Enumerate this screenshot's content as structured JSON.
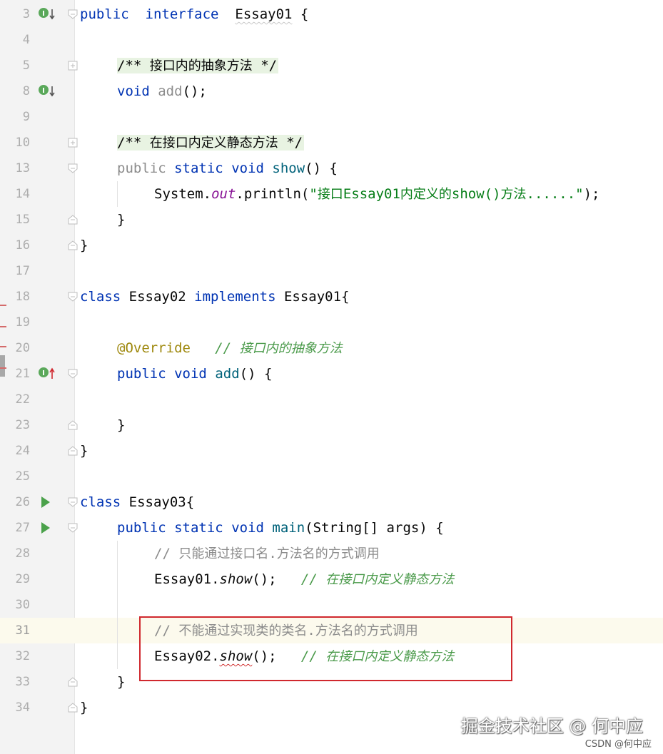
{
  "editor": {
    "lines": [
      {
        "num": "3",
        "segments": [
          [
            "kw",
            "public"
          ],
          [
            "",
            "  "
          ],
          [
            "kw",
            "interface"
          ],
          [
            "",
            "  "
          ],
          [
            "squig-soft",
            "Essay01"
          ],
          [
            "",
            " {"
          ]
        ]
      },
      {
        "num": "4",
        "segments": []
      },
      {
        "num": "5",
        "segments": [
          [
            "",
            ""
          ],
          [
            "doc",
            "/** 接口内的抽象方法 */"
          ]
        ]
      },
      {
        "num": "8",
        "segments": [
          [
            "kw",
            "void"
          ],
          [
            "",
            " "
          ],
          [
            "gray",
            "add"
          ],
          [
            "",
            "();"
          ]
        ]
      },
      {
        "num": "9",
        "segments": []
      },
      {
        "num": "10",
        "segments": [
          [
            "doc",
            "/** 在接口内定义静态方法 */"
          ]
        ]
      },
      {
        "num": "13",
        "segments": [
          [
            "gray",
            "public"
          ],
          [
            "",
            " "
          ],
          [
            "kw",
            "static"
          ],
          [
            "",
            " "
          ],
          [
            "kw",
            "void"
          ],
          [
            "",
            " "
          ],
          [
            "fn",
            "show"
          ],
          [
            "",
            "() {"
          ]
        ]
      },
      {
        "num": "14",
        "segments": [
          [
            "",
            "System."
          ],
          [
            "fld",
            "out"
          ],
          [
            "",
            ".println("
          ],
          [
            "str",
            "\"接口Essay01内定义的show()方法......\""
          ],
          [
            "",
            ");"
          ]
        ]
      },
      {
        "num": "15",
        "segments": [
          [
            "",
            "}"
          ]
        ]
      },
      {
        "num": "16",
        "segments": [
          [
            "",
            "}"
          ]
        ]
      },
      {
        "num": "17",
        "segments": []
      },
      {
        "num": "18",
        "segments": [
          [
            "kw",
            "class"
          ],
          [
            "",
            " Essay02 "
          ],
          [
            "kw",
            "implements"
          ],
          [
            "",
            " Essay01{"
          ]
        ]
      },
      {
        "num": "19",
        "segments": []
      },
      {
        "num": "20",
        "segments": [
          [
            "ann",
            "@Override"
          ],
          [
            "",
            "   "
          ],
          [
            "cmt-green",
            "// 接口内的抽象方法"
          ]
        ]
      },
      {
        "num": "21",
        "segments": [
          [
            "kw",
            "public"
          ],
          [
            "",
            " "
          ],
          [
            "kw",
            "void"
          ],
          [
            "",
            " "
          ],
          [
            "fn",
            "add"
          ],
          [
            "",
            "() {"
          ]
        ]
      },
      {
        "num": "22",
        "segments": []
      },
      {
        "num": "23",
        "segments": [
          [
            "",
            "}"
          ]
        ]
      },
      {
        "num": "24",
        "segments": [
          [
            "",
            "}"
          ]
        ]
      },
      {
        "num": "25",
        "segments": []
      },
      {
        "num": "26",
        "segments": [
          [
            "kw",
            "class"
          ],
          [
            "",
            " Essay03{"
          ]
        ]
      },
      {
        "num": "27",
        "segments": [
          [
            "kw",
            "public"
          ],
          [
            "",
            " "
          ],
          [
            "kw",
            "static"
          ],
          [
            "",
            " "
          ],
          [
            "kw",
            "void"
          ],
          [
            "",
            " "
          ],
          [
            "fn",
            "main"
          ],
          [
            "",
            "(String[] args) {"
          ]
        ]
      },
      {
        "num": "28",
        "segments": [
          [
            "cmt",
            "// 只能通过接口名.方法名的方式调用"
          ]
        ]
      },
      {
        "num": "29",
        "segments": [
          [
            "",
            "Essay01."
          ],
          [
            "fnit",
            "show"
          ],
          [
            "",
            "();   "
          ],
          [
            "cmt-green",
            "// 在接口内定义静态方法"
          ]
        ]
      },
      {
        "num": "30",
        "segments": []
      },
      {
        "num": "31",
        "segments": [
          [
            "cmt",
            "// 不能通过实现类的类名.方法名的方式调用"
          ]
        ]
      },
      {
        "num": "32",
        "segments": [
          [
            "",
            "Essay02."
          ],
          [
            "fnit-squig",
            "show"
          ],
          [
            "",
            "();   "
          ],
          [
            "cmt-green",
            "// 在接口内定义静态方法"
          ]
        ]
      },
      {
        "num": "33",
        "segments": [
          [
            "",
            "}"
          ]
        ]
      },
      {
        "num": "34",
        "segments": [
          [
            "",
            "}"
          ]
        ]
      }
    ],
    "current_line": "31"
  },
  "watermark": {
    "main": "掘金技术社区 @ 何中应",
    "sub": "CSDN @何中应"
  },
  "colors": {
    "keyword": "#0033b3",
    "string": "#067d17",
    "annotation": "#9e880d",
    "comment": "#8c8c8c",
    "highlight_box": "#d0282e"
  }
}
